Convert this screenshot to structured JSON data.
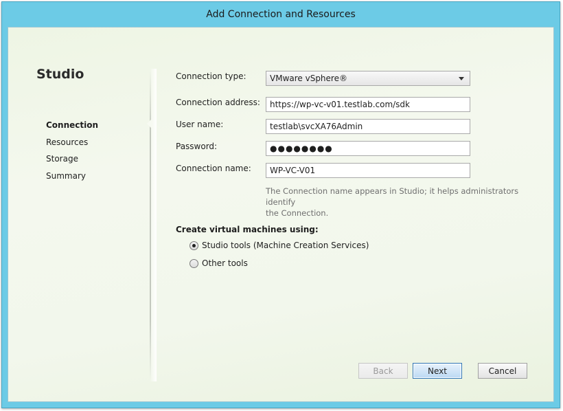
{
  "window": {
    "title": "Add Connection and Resources"
  },
  "sidebar": {
    "heading": "Studio",
    "items": [
      {
        "label": "Connection",
        "active": true
      },
      {
        "label": "Resources",
        "active": false
      },
      {
        "label": "Storage",
        "active": false
      },
      {
        "label": "Summary",
        "active": false
      }
    ]
  },
  "form": {
    "connection_type": {
      "label": "Connection type:",
      "value": "VMware vSphere®"
    },
    "connection_address": {
      "label": "Connection address:",
      "value": "https://wp-vc-v01.testlab.com/sdk"
    },
    "user_name": {
      "label": "User name:",
      "value": "testlab\\svcXA76Admin"
    },
    "password": {
      "label": "Password:",
      "value": "●●●●●●●●"
    },
    "connection_name": {
      "label": "Connection name:",
      "value": "WP-VC-V01"
    },
    "hint_line1": "The Connection name appears in Studio; it helps administrators identify",
    "hint_line2": "the Connection."
  },
  "vm_section": {
    "label": "Create virtual machines using:",
    "options": [
      {
        "label": "Studio tools (Machine Creation Services)",
        "selected": true
      },
      {
        "label": "Other tools",
        "selected": false
      }
    ]
  },
  "buttons": {
    "back": "Back",
    "next": "Next",
    "cancel": "Cancel"
  },
  "colors": {
    "title_bar": "#6ccbe6",
    "primary_button_border": "#2f74b5"
  }
}
